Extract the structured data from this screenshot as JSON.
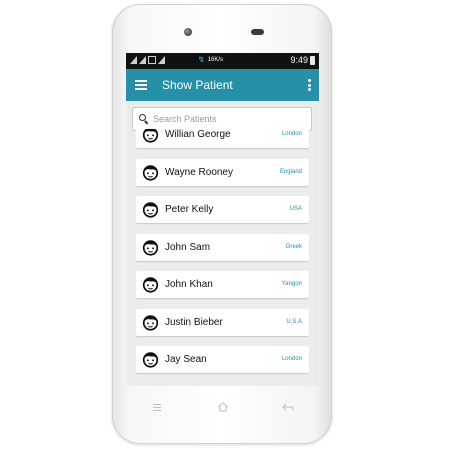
{
  "status_bar": {
    "speed": "16K/s",
    "time": "9:49"
  },
  "app_bar": {
    "title": "Show Patient",
    "menu_icon": "hamburger-icon",
    "overflow_icon": "more-vert-icon",
    "color": "#2590a8"
  },
  "search": {
    "placeholder": "Search Patients",
    "icon": "search-icon"
  },
  "patients": [
    {
      "name": "Willian George",
      "location": "London"
    },
    {
      "name": "Wayne Rooney",
      "location": "England"
    },
    {
      "name": "Peter Kelly",
      "location": "USA"
    },
    {
      "name": "John Sam",
      "location": "Greek"
    },
    {
      "name": "John Khan",
      "location": "Yangon"
    },
    {
      "name": "Justin Bieber",
      "location": "U.S.A"
    },
    {
      "name": "Jay Sean",
      "location": "London"
    }
  ],
  "nav": {
    "menu_icon": "menu-icon",
    "home_icon": "home-icon",
    "back_icon": "back-icon"
  }
}
